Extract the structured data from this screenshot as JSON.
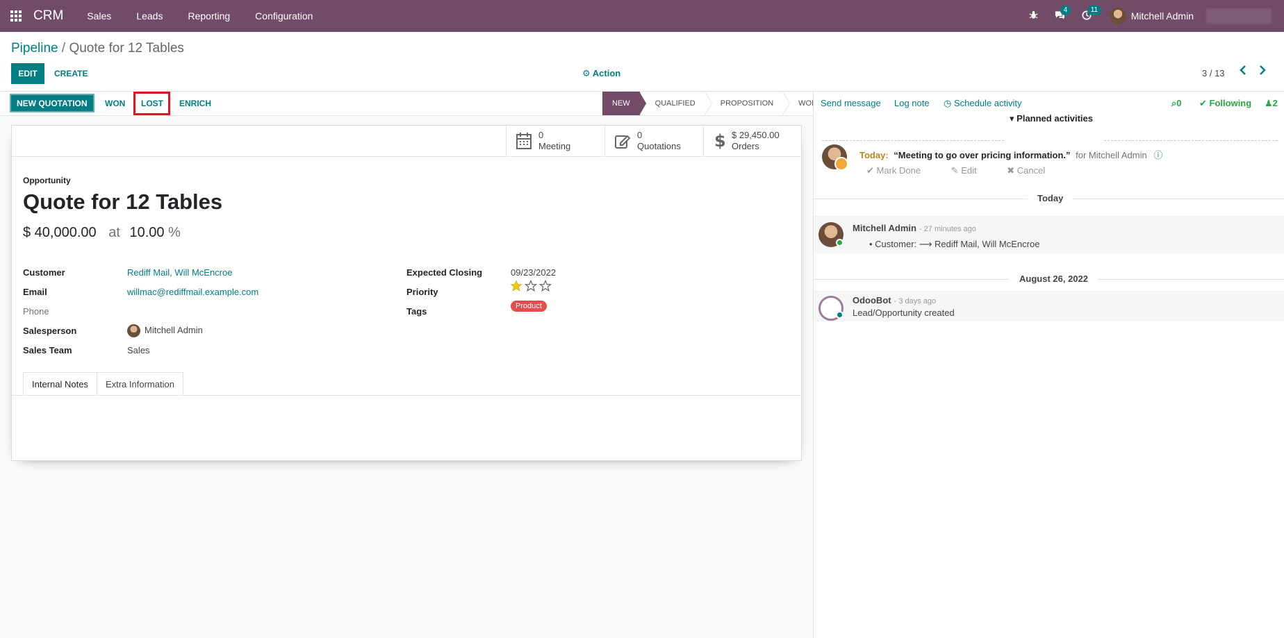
{
  "navbar": {
    "brand": "CRM",
    "menu": [
      "Sales",
      "Leads",
      "Reporting",
      "Configuration"
    ],
    "messages_badge": "4",
    "activities_badge": "11",
    "user_name": "Mitchell Admin"
  },
  "breadcrumb": {
    "parent": "Pipeline",
    "separator": "/",
    "current": "Quote for 12 Tables"
  },
  "control": {
    "edit": "EDIT",
    "create": "CREATE",
    "action": "Action",
    "pager": "3 / 13"
  },
  "header_buttons": {
    "new_quotation": "NEW QUOTATION",
    "won": "WON",
    "lost": "LOST",
    "enrich": "ENRICH"
  },
  "stages": [
    "NEW",
    "QUALIFIED",
    "PROPOSITION",
    "WON"
  ],
  "active_stage": "NEW",
  "stat_buttons": [
    {
      "value": "0",
      "label": "Meeting"
    },
    {
      "value": "0",
      "label": "Quotations"
    },
    {
      "value": "$ 29,450.00",
      "label": "Orders"
    }
  ],
  "record": {
    "type_label": "Opportunity",
    "name": "Quote for 12 Tables",
    "expected_revenue": "$ 40,000.00",
    "at": "at",
    "probability": "10.00",
    "pct": "%"
  },
  "fields_left": [
    {
      "label": "Customer",
      "value": "Rediff Mail, Will McEncroe"
    },
    {
      "label": "Email",
      "value": "willmac@rediffmail.example.com"
    },
    {
      "label": "Phone",
      "value": ""
    },
    {
      "label": "Salesperson",
      "value": "Mitchell Admin"
    },
    {
      "label": "Sales Team",
      "value": "Sales"
    }
  ],
  "fields_right": [
    {
      "label": "Expected Closing",
      "value": "09/23/2022"
    },
    {
      "label": "Priority",
      "value": "1 of 3"
    },
    {
      "label": "Tags",
      "value": "Product"
    }
  ],
  "priority_stars": 1,
  "tabs": [
    "Internal Notes",
    "Extra Information"
  ],
  "chatter": {
    "send_message": "Send message",
    "log_note": "Log note",
    "schedule_activity": "Schedule activity",
    "attachments": "0",
    "following": "Following",
    "followers": "2",
    "planned_title": "Planned activities",
    "activity": {
      "when": "Today:",
      "summary": "“Meeting to go over pricing information.”",
      "for": "for Mitchell Admin",
      "mark_done": "Mark Done",
      "edit": "Edit",
      "cancel": "Cancel"
    },
    "sep_today": "Today",
    "msg1": {
      "author": "Mitchell Admin",
      "time": "- 27 minutes ago",
      "body": "Customer: ⟶ Rediff Mail, Will McEncroe"
    },
    "sep_date": "August 26, 2022",
    "msg2": {
      "author": "OdooBot",
      "time": "- 3 days ago",
      "body": "Lead/Opportunity created"
    }
  },
  "colors": {
    "brand": "#714b67",
    "accent": "#017e84",
    "lost_highlight": "#e1141e",
    "tag": "#e54d4d"
  }
}
